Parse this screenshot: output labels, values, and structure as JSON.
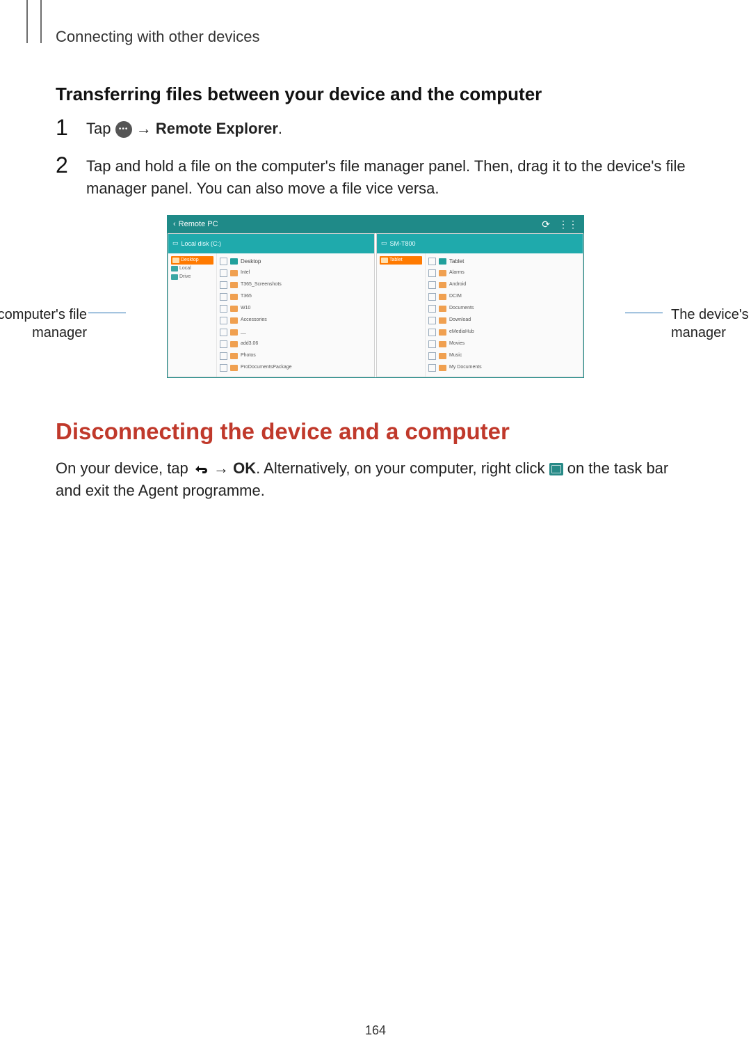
{
  "header": "Connecting with other devices",
  "subheading": "Transferring files between your device and the computer",
  "steps": [
    {
      "num": "1",
      "pre": "Tap ",
      "post_arrow": " → ",
      "bold": "Remote Explorer",
      "end": "."
    },
    {
      "num": "2",
      "text": "Tap and hold a file on the computer's file manager panel. Then, drag it to the device's file manager panel. You can also move a file vice versa."
    }
  ],
  "figure": {
    "titlebar_back": "Remote PC",
    "refresh_glyph": "⟳",
    "grid_glyph": "⋮⋮",
    "left_callout": "The computer's file manager",
    "right_callout": "The device's file manager",
    "left_pane": {
      "header_label": "Local disk (C:)",
      "breadcrumb_label": "Desktop",
      "tree": [
        {
          "label": "Desktop",
          "selected": true
        },
        {
          "label": "Local",
          "selected": false
        },
        {
          "label": "Drive",
          "selected": false
        }
      ],
      "rows": [
        {
          "name": "Intel",
          "sub": ""
        },
        {
          "name": "T365_Screenshots",
          "sub": ""
        },
        {
          "name": "T365",
          "sub": ""
        },
        {
          "name": "W10",
          "sub": ""
        },
        {
          "name": "Accessories",
          "sub": ""
        },
        {
          "name": "__",
          "sub": ""
        },
        {
          "name": "add3.06",
          "sub": ""
        },
        {
          "name": "Photos",
          "sub": ""
        },
        {
          "name": "ProDocumentsPackage",
          "sub": ""
        }
      ]
    },
    "right_pane": {
      "header_label": "SM-T800",
      "breadcrumb_label": "Tablet",
      "tree": [
        {
          "label": "Tablet",
          "selected": true
        }
      ],
      "rows": [
        {
          "name": "Alarms",
          "sub": ""
        },
        {
          "name": "Android",
          "sub": ""
        },
        {
          "name": "DCIM",
          "sub": ""
        },
        {
          "name": "Documents",
          "sub": ""
        },
        {
          "name": "Download",
          "sub": ""
        },
        {
          "name": "eMediaHub",
          "sub": ""
        },
        {
          "name": "Movies",
          "sub": ""
        },
        {
          "name": "Music",
          "sub": ""
        },
        {
          "name": "My Documents",
          "sub": ""
        }
      ]
    }
  },
  "section2": {
    "title": "Disconnecting the device and a computer",
    "pre": "On your device, tap ",
    "arrow": " → ",
    "ok": "OK",
    "mid": ". Alternatively, on your computer, right click ",
    "post": " on the task bar and exit the Agent programme."
  },
  "page_number": "164"
}
